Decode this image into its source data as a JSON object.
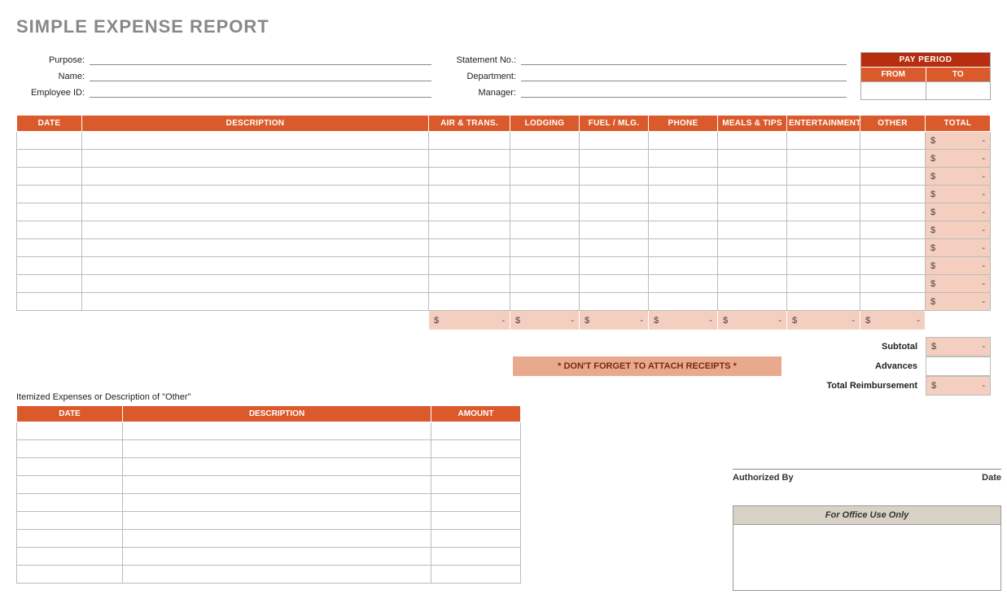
{
  "title": "SIMPLE EXPENSE REPORT",
  "info_left": {
    "purpose": "Purpose:",
    "name": "Name:",
    "employee_id": "Employee ID:"
  },
  "info_right": {
    "statement_no": "Statement No.:",
    "department": "Department:",
    "manager": "Manager:"
  },
  "pay_period": {
    "title": "PAY PERIOD",
    "from": "FROM",
    "to": "TO"
  },
  "main_headers": {
    "date": "DATE",
    "description": "DESCRIPTION",
    "air": "AIR & TRANS.",
    "lodging": "LODGING",
    "fuel": "FUEL / MLG.",
    "phone": "PHONE",
    "meals": "MEALS & TIPS",
    "entertainment": "ENTERTAINMENT",
    "other": "OTHER",
    "total": "TOTAL"
  },
  "money": {
    "sym": "$",
    "dash": "-"
  },
  "summary": {
    "subtotal": "Subtotal",
    "advances": "Advances",
    "total_reimbursement": "Total Reimbursement"
  },
  "receipts_banner": "* DON'T FORGET TO ATTACH RECEIPTS *",
  "itemized": {
    "title": "Itemized Expenses or Description of \"Other\"",
    "headers": {
      "date": "DATE",
      "description": "DESCRIPTION",
      "amount": "AMOUNT"
    }
  },
  "signature": {
    "authorized_by": "Authorized By",
    "date": "Date"
  },
  "office": {
    "title": "For Office Use Only"
  }
}
